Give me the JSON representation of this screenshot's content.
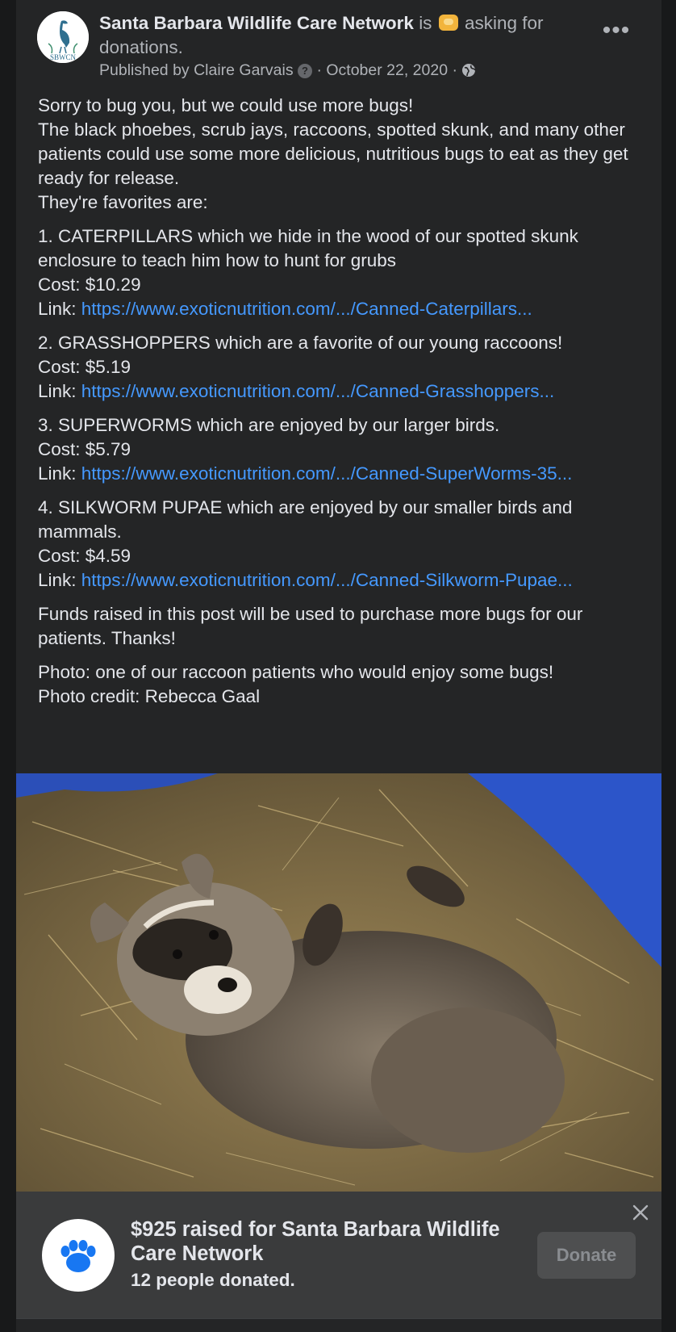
{
  "header": {
    "page_name": "Santa Barbara Wildlife Care Network",
    "action_prefix": "is",
    "action_text": "asking for donations.",
    "published_by": "Published by Claire Garvais",
    "question_mark": "?",
    "date": "· October 22, 2020 ·",
    "avatar_text": "SBWCN",
    "more_label": "•••"
  },
  "post": {
    "intro": [
      "Sorry to bug you, but we could use more bugs!",
      "The black phoebes, scrub jays, raccoons, spotted skunk, and many other patients could use some more delicious, nutritious bugs to eat as they get ready for release.",
      "They're favorites are:"
    ],
    "items": [
      {
        "title": "1. CATERPILLARS which we hide in the wood of our spotted skunk enclosure to teach him how to hunt for grubs",
        "cost": "Cost: $10.29",
        "link_label": "Link: ",
        "link": "https://www.exoticnutrition.com/.../Canned-Caterpillars..."
      },
      {
        "title": "2. GRASSHOPPERS which are a favorite of our young raccoons!",
        "cost": "Cost: $5.19",
        "link_label": "Link: ",
        "link": "https://www.exoticnutrition.com/.../Canned-Grasshoppers..."
      },
      {
        "title": "3. SUPERWORMS which are enjoyed by our larger birds.",
        "cost": "Cost: $5.79",
        "link_label": "Link: ",
        "link": "https://www.exoticnutrition.com/.../Canned-SuperWorms-35..."
      },
      {
        "title": "4. SILKWORM PUPAE which are enjoyed by our smaller birds and mammals.",
        "cost": "Cost: $4.59",
        "link_label": "Link: ",
        "link": "https://www.exoticnutrition.com/.../Canned-Silkworm-Pupae..."
      }
    ],
    "closing": "Funds raised in this post will be used to purchase more bugs for our patients. Thanks!",
    "photo_caption": "Photo: one of our raccoon patients who would enjoy some bugs!",
    "photo_credit": "Photo credit: Rebecca Gaal"
  },
  "fundraiser": {
    "title": "$925 raised for Santa Barbara Wildlife Care Network",
    "donors": "12 people donated.",
    "donate_label": "Donate"
  },
  "colors": {
    "background": "#18191a",
    "card": "#242526",
    "text": "#e4e6eb",
    "secondary_text": "#b0b3b8",
    "link": "#4599ff",
    "fundraiser_bg": "#3a3b3c",
    "paw": "#1877f2"
  },
  "icons": [
    "more-options-icon",
    "question-icon",
    "globe-icon",
    "close-icon",
    "paw-icon"
  ]
}
